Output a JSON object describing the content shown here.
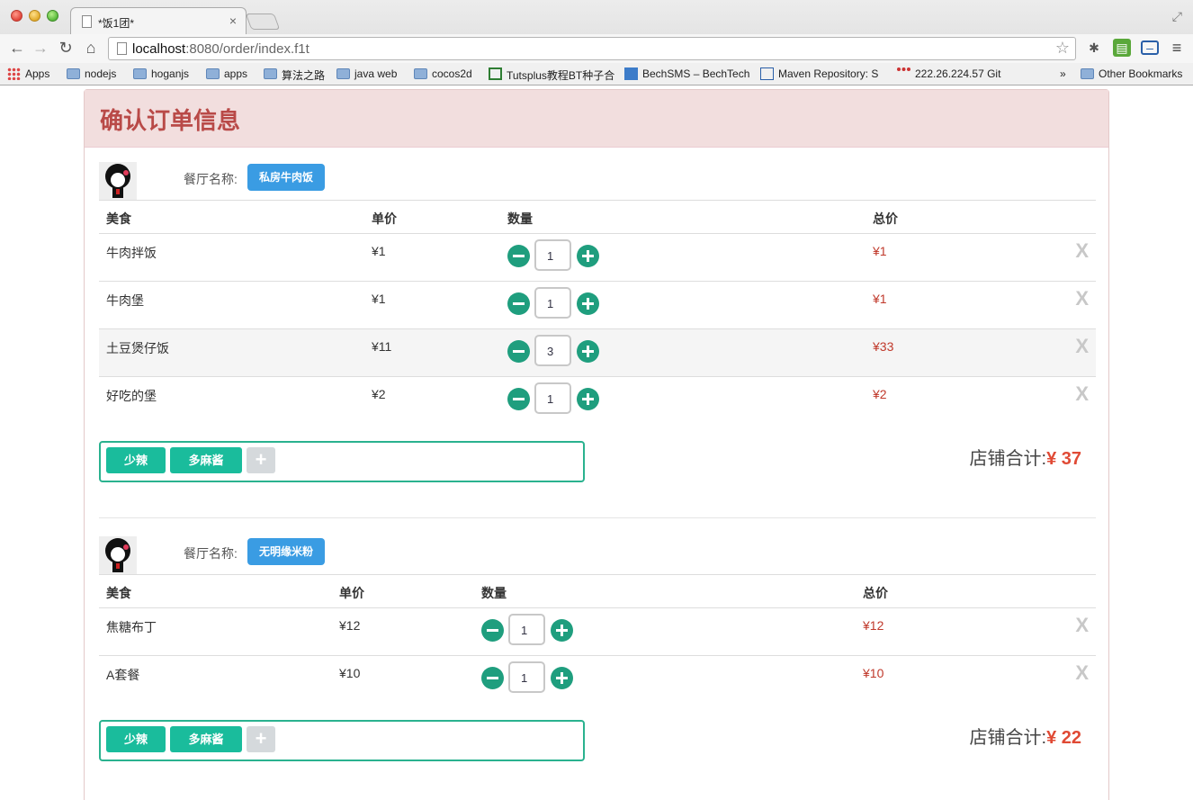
{
  "browser": {
    "tab_title": "*饭1团*",
    "tab_close": "×",
    "url_host": "localhost",
    "url_path": ":8080/order/index.f1t",
    "bookmarks": [
      {
        "label": "Apps"
      },
      {
        "label": "nodejs"
      },
      {
        "label": "hoganjs"
      },
      {
        "label": "apps"
      },
      {
        "label": "算法之路"
      },
      {
        "label": "java web"
      },
      {
        "label": "cocos2d"
      },
      {
        "label": "Tutsplus教程BT种子合"
      },
      {
        "label": "BechSMS – BechTech"
      },
      {
        "label": "Maven Repository: S"
      },
      {
        "label": "222.26.224.57 Git"
      },
      {
        "label": "»"
      },
      {
        "label": "Other Bookmarks"
      }
    ]
  },
  "page": {
    "title": "确认订单信息"
  },
  "shops": [
    {
      "label": "餐厅名称:",
      "name": "私房牛肉饭",
      "columns": {
        "food": "美食",
        "price": "单价",
        "qty": "数量",
        "total": "总价"
      },
      "items": [
        {
          "food": "牛肉拌饭",
          "price": "¥1",
          "qty": "1",
          "total": "¥1"
        },
        {
          "food": "牛肉堡",
          "price": "¥1",
          "qty": "1",
          "total": "¥1"
        },
        {
          "food": "土豆煲仔饭",
          "price": "¥11",
          "qty": "3",
          "total": "¥33"
        },
        {
          "food": "好吃的堡",
          "price": "¥2",
          "qty": "1",
          "total": "¥2"
        }
      ],
      "tags": [
        "少辣",
        "多麻酱"
      ],
      "tag_add": "+",
      "total_label": "店铺合计:",
      "total_value": "¥ 37"
    },
    {
      "label": "餐厅名称:",
      "name": "无明缘米粉",
      "columns": {
        "food": "美食",
        "price": "单价",
        "qty": "数量",
        "total": "总价"
      },
      "items": [
        {
          "food": "焦糖布丁",
          "price": "¥12",
          "qty": "1",
          "total": "¥12"
        },
        {
          "food": "A套餐",
          "price": "¥10",
          "qty": "1",
          "total": "¥10"
        }
      ],
      "tags": [
        "少辣",
        "多麻酱"
      ],
      "tag_add": "+",
      "total_label": "店铺合计:",
      "total_value": "¥ 22"
    }
  ],
  "delete_label": "X",
  "colors": {
    "header_bg": "#f2dede",
    "header_text": "#b94a48",
    "shop_name_bg": "#3a9ce3",
    "qty_button": "#1f9e7e",
    "tag_bg": "#1abc9c",
    "price_total": "#e04a35"
  }
}
